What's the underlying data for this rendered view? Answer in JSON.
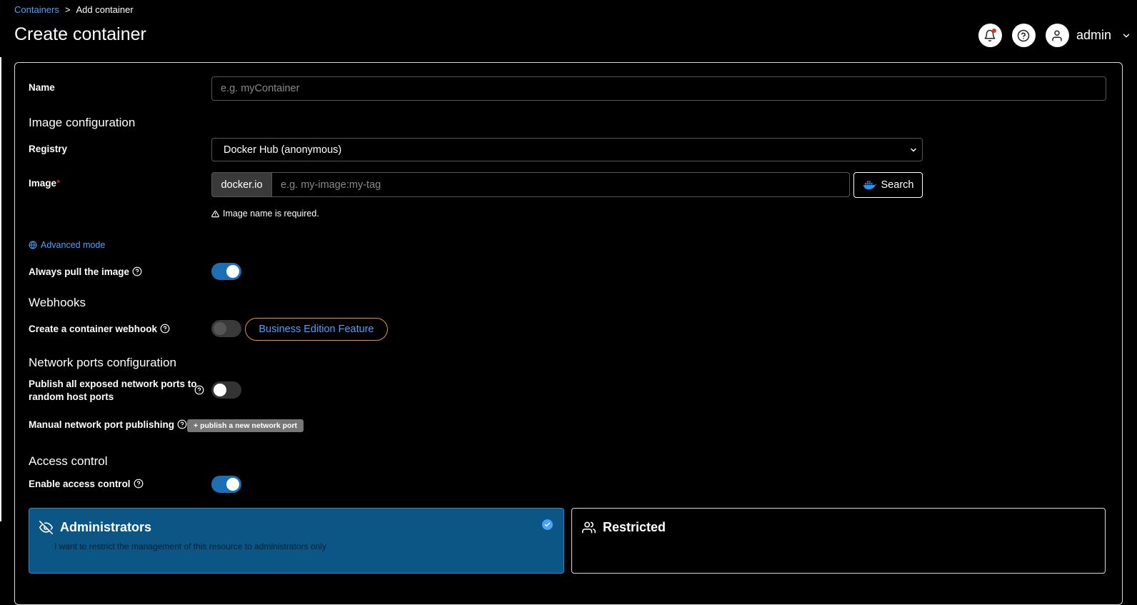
{
  "breadcrumb": {
    "parent": "Containers",
    "separator": ">",
    "current": "Add container"
  },
  "page": {
    "title": "Create container"
  },
  "header": {
    "user": "admin"
  },
  "form": {
    "name": {
      "label": "Name",
      "placeholder": "e.g. myContainer",
      "value": ""
    },
    "image_section": "Image configuration",
    "registry": {
      "label": "Registry",
      "value": "Docker Hub (anonymous)"
    },
    "image": {
      "label": "Image",
      "required_mark": "*",
      "prefix": "docker.io",
      "placeholder": "e.g. my-image:my-tag",
      "value": "",
      "search_label": "Search",
      "error": "Image name is required."
    },
    "advanced_mode": "Advanced mode",
    "always_pull": {
      "label": "Always pull the image",
      "enabled": true
    },
    "webhooks_section": "Webhooks",
    "webhook": {
      "label": "Create a container webhook",
      "enabled": false,
      "badge": "Business Edition Feature"
    },
    "network_section": "Network ports configuration",
    "publish_all": {
      "label_line1": "Publish all exposed network ports to",
      "label_line2": "random host ports",
      "enabled": false
    },
    "manual_publish": {
      "label": "Manual network port publishing",
      "button_icon": "+",
      "button_label": "publish a new network port"
    },
    "access_section": "Access control",
    "access_control": {
      "label": "Enable access control",
      "enabled": true
    },
    "options": [
      {
        "title": "Administrators",
        "description": "I want to restrict the management of this resource to administrators only",
        "selected": true
      },
      {
        "title": "Restricted",
        "description": "",
        "selected": false
      }
    ]
  },
  "colors": {
    "accent": "#1b6fb2",
    "link": "#4aa3ff",
    "selected_card": "#0b5685",
    "badge_border": "#e8903a",
    "error_dot": "#e5332a"
  }
}
